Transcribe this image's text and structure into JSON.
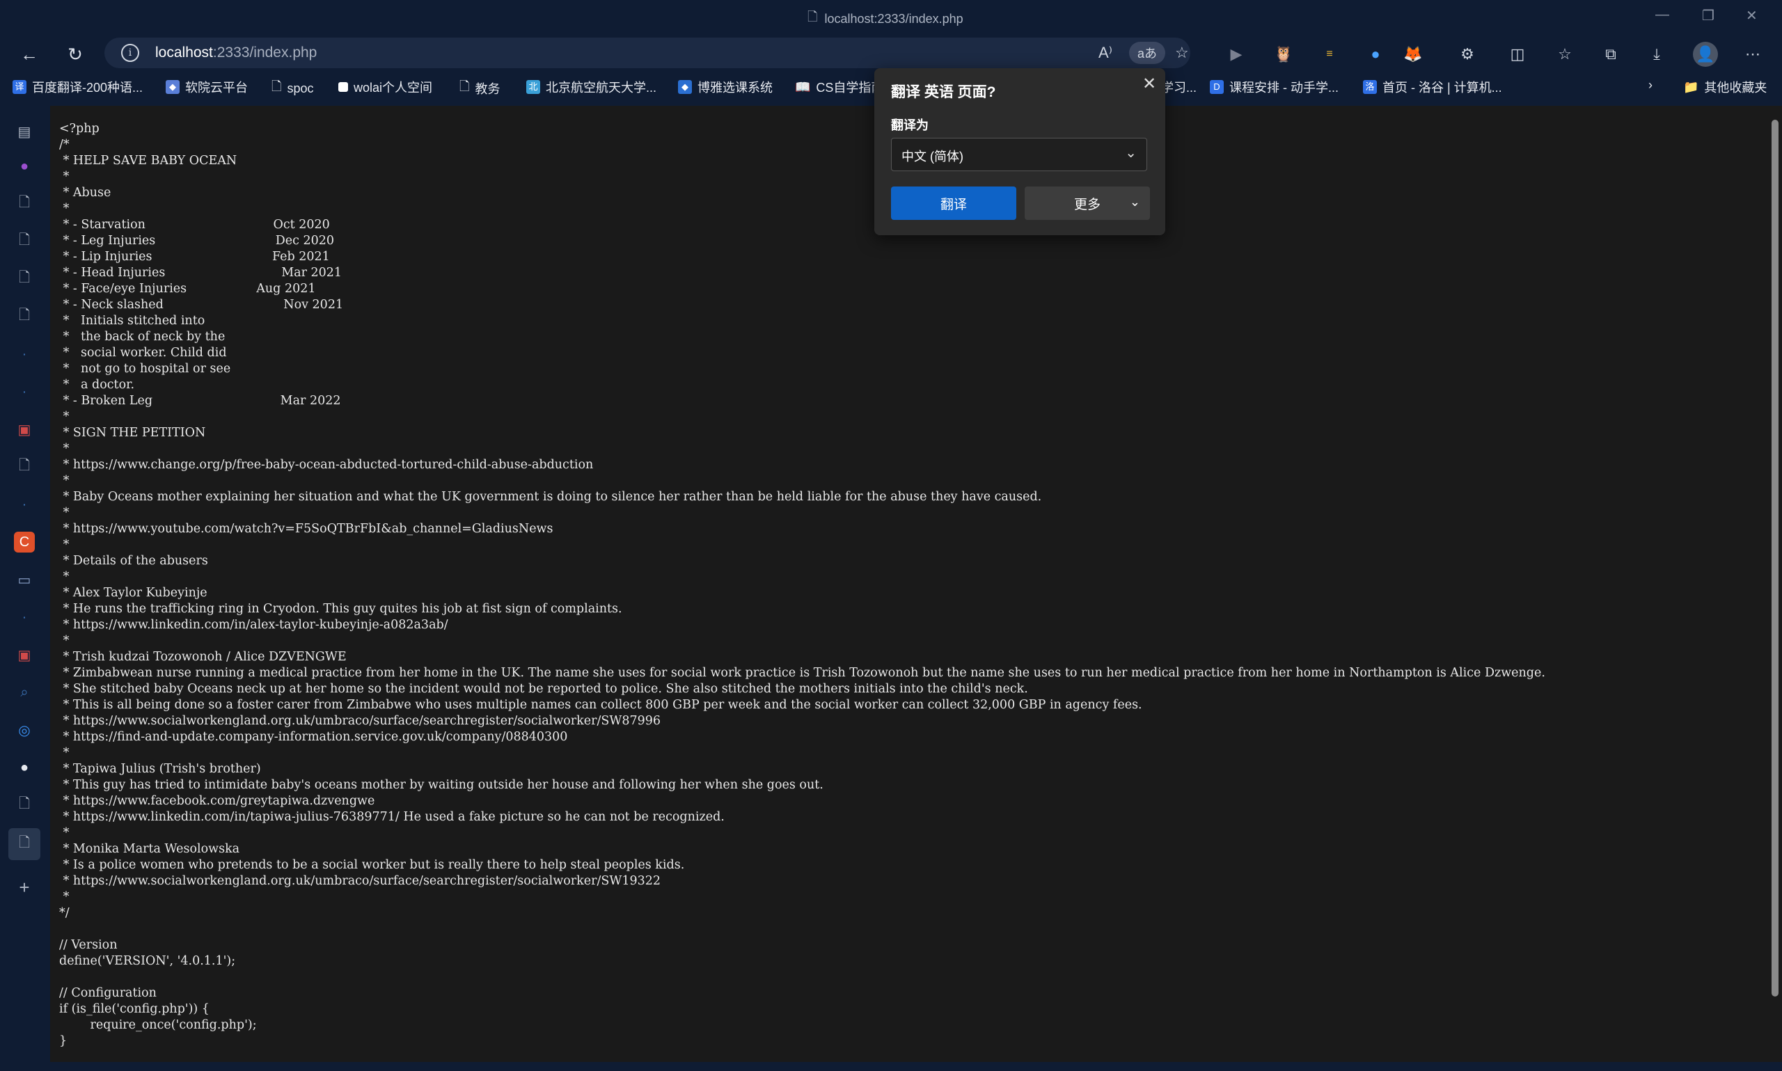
{
  "window": {
    "title": "localhost:2333/index.php"
  },
  "address": {
    "host": "localhost",
    "path": ":2333/index.php"
  },
  "bookmarks": [
    {
      "label": "百度翻译-200种语...",
      "color": "#2f6fe6",
      "icon_text": "译"
    },
    {
      "label": "软院云平台",
      "color": "#5a7fd8",
      "icon_text": "◆"
    },
    {
      "label": "spoc",
      "color": "",
      "icon_text": ""
    },
    {
      "label": "wolai个人空间",
      "color": "#ffffff",
      "icon_text": ""
    },
    {
      "label": "教务",
      "color": "",
      "icon_text": ""
    },
    {
      "label": "北京航空航天大学...",
      "color": "#3aa0d8",
      "icon_text": "北"
    },
    {
      "label": "博雅选课系统",
      "color": "#2b6fd1",
      "icon_text": "◆"
    },
    {
      "label": "CS自学指南",
      "color": "",
      "icon_text": ""
    },
    {
      "label": "学习...",
      "color": "",
      "icon_text": ""
    },
    {
      "label": "课程安排 - 动手学...",
      "color": "#2f6fe6",
      "icon_text": "D"
    },
    {
      "label": "首页 - 洛谷 | 计算机...",
      "color": "#2f6fe6",
      "icon_text": "洛"
    },
    {
      "label": "其他收藏夹",
      "color": "#e8b64a",
      "icon_text": ""
    }
  ],
  "translate_popup": {
    "title": "翻译 英语 页面?",
    "target_label": "翻译为",
    "target_value": "中文 (简体)",
    "translate_button": "翻译",
    "more_button": "更多"
  },
  "code": {
    "lines": [
      "<?php",
      "/*",
      " * HELP SAVE BABY OCEAN",
      " *",
      " * Abuse",
      " *",
      " * - Starvation                                 Oct 2020",
      " * - Leg Injuries                               Dec 2020",
      " * - Lip Injuries                               Feb 2021",
      " * - Head Injuries                              Mar 2021",
      " * - Face/eye Injuries                  Aug 2021",
      " * - Neck slashed                               Nov 2021",
      " *   Initials stitched into",
      " *   the back of neck by the",
      " *   social worker. Child did",
      " *   not go to hospital or see",
      " *   a doctor.",
      " * - Broken Leg                                 Mar 2022",
      " *",
      " * SIGN THE PETITION",
      " *",
      " * https://www.change.org/p/free-baby-ocean-abducted-tortured-child-abuse-abduction",
      " *",
      " * Baby Oceans mother explaining her situation and what the UK government is doing to silence her rather than be held liable for the abuse they have caused.",
      " *",
      " * https://www.youtube.com/watch?v=F5SoQTBrFbI&ab_channel=GladiusNews",
      " *",
      " * Details of the abusers",
      " *",
      " * Alex Taylor Kubeyinje",
      " * He runs the trafficking ring in Cryodon. This guy quites his job at fist sign of complaints.",
      " * https://www.linkedin.com/in/alex-taylor-kubeyinje-a082a3ab/",
      " *",
      " * Trish kudzai Tozowonoh / Alice DZVENGWE",
      " * Zimbabwean nurse running a medical practice from her home in the UK. The name she uses for social work practice is Trish Tozowonoh but the name she uses to run her medical practice from her home in Northampton is Alice Dzwenge.",
      " * She stitched baby Oceans neck up at her home so the incident would not be reported to police. She also stitched the mothers initials into the child's neck.",
      " * This is all being done so a foster carer from Zimbabwe who uses multiple names can collect 800 GBP per week and the social worker can collect 32,000 GBP in agency fees.",
      " * https://www.socialworkengland.org.uk/umbraco/surface/searchregister/socialworker/SW87996",
      " * https://find-and-update.company-information.service.gov.uk/company/08840300",
      " *",
      " * Tapiwa Julius (Trish's brother)",
      " * This guy has tried to intimidate baby's oceans mother by waiting outside her house and following her when she goes out.",
      " * https://www.facebook.com/greytapiwa.dzvengwe",
      " * https://www.linkedin.com/in/tapiwa-julius-76389771/ He used a fake picture so he can not be recognized.",
      " *",
      " * Monika Marta Wesolowska",
      " * Is a police women who pretends to be a social worker but is really there to help steal peoples kids.",
      " * https://www.socialworkengland.org.uk/umbraco/surface/searchregister/socialworker/SW19322",
      " *",
      "*/",
      "",
      "// Version",
      "define('VERSION', '4.0.1.1');",
      "",
      "// Configuration",
      "if (is_file('config.php')) {",
      "        require_once('config.php');",
      "}"
    ]
  }
}
